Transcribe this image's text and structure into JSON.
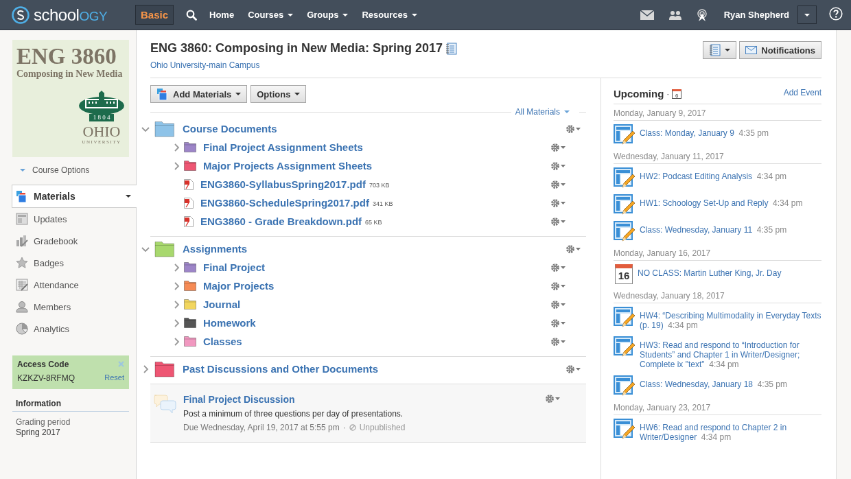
{
  "topbar": {
    "logo": {
      "text_1": "school",
      "text_2": "OGY"
    },
    "mode_button": "Basic",
    "menus": [
      {
        "label": "Home",
        "dropdown": false
      },
      {
        "label": "Courses",
        "dropdown": true
      },
      {
        "label": "Groups",
        "dropdown": true
      },
      {
        "label": "Resources",
        "dropdown": true
      }
    ],
    "user_name": "Ryan Shepherd"
  },
  "sidebar": {
    "course_image": {
      "title": "ENG 3860",
      "subtitle": "Composing in New Media",
      "year": "1 8 0 4",
      "name": "OHIO",
      "label": "UNIVERSITY"
    },
    "course_options": "Course Options",
    "nav": [
      {
        "label": "Materials",
        "selected": true
      },
      {
        "label": "Updates",
        "selected": false
      },
      {
        "label": "Gradebook",
        "selected": false
      },
      {
        "label": "Badges",
        "selected": false
      },
      {
        "label": "Attendance",
        "selected": false
      },
      {
        "label": "Members",
        "selected": false
      },
      {
        "label": "Analytics",
        "selected": false
      }
    ],
    "access_code": {
      "label": "Access Code",
      "code": "KZKZV-8RFMQ",
      "reset": "Reset"
    },
    "information": {
      "heading": "Information",
      "label": "Grading period",
      "value": "Spring 2017"
    }
  },
  "header": {
    "title": "ENG 3860: Composing in New Media: Spring 2017",
    "subtitle": "Ohio University-main Campus",
    "notifications_button": "Notifications"
  },
  "toolbar": {
    "add_materials": "Add Materials",
    "options": "Options",
    "filter": "All Materials"
  },
  "materials": [
    {
      "kind": "folder",
      "name": "Course Documents",
      "color": "#8ec3e8",
      "expanded": true,
      "children": [
        {
          "kind": "folder",
          "name": "Final Project Assignment Sheets",
          "color": "#9d85c8",
          "expanded": false
        },
        {
          "kind": "folder",
          "name": "Major Projects Assignment Sheets",
          "color": "#ee5673",
          "expanded": false
        },
        {
          "kind": "file",
          "name": "ENG3860-SyllabusSpring2017.pdf",
          "size": "703 KB"
        },
        {
          "kind": "file",
          "name": "ENG3860-ScheduleSpring2017.pdf",
          "size": "341 KB"
        },
        {
          "kind": "file",
          "name": "ENG3860 - Grade Breakdown.pdf",
          "size": "65 KB"
        }
      ]
    },
    {
      "kind": "folder",
      "name": "Assignments",
      "color": "#a8d86e",
      "expanded": true,
      "children": [
        {
          "kind": "folder",
          "name": "Final Project",
          "color": "#9d85c8",
          "expanded": false
        },
        {
          "kind": "folder",
          "name": "Major Projects",
          "color": "#f68b55",
          "expanded": false
        },
        {
          "kind": "folder",
          "name": "Journal",
          "color": "#f2d65e",
          "expanded": false
        },
        {
          "kind": "folder",
          "name": "Homework",
          "color": "#555555",
          "expanded": false
        },
        {
          "kind": "folder",
          "name": "Classes",
          "color": "#f198c0",
          "expanded": false
        }
      ]
    },
    {
      "kind": "folder",
      "name": "Past Discussions and Other Documents",
      "color": "#ee5673",
      "expanded": false
    },
    {
      "kind": "discussion",
      "name": "Final Project Discussion",
      "description": "Post a minimum of three questions per day of presentations.",
      "due": "Due Wednesday, April 19, 2017 at 5:55 pm",
      "separator": "·",
      "status": "Unpublished"
    }
  ],
  "upcoming": {
    "title": "Upcoming",
    "separator": "·",
    "calendar_day": "6",
    "add_event": "Add Event",
    "days": [
      {
        "date": "Monday, January 9, 2017",
        "events": [
          {
            "kind": "assignment",
            "title": "Class: Monday, January 9",
            "time": "4:35 pm"
          }
        ]
      },
      {
        "date": "Wednesday, January 11, 2017",
        "events": [
          {
            "kind": "assignment",
            "title": "HW2: Podcast Editing Analysis",
            "time": "4:34 pm"
          },
          {
            "kind": "assignment",
            "title": "HW1: Schoology Set-Up and Reply",
            "time": "4:34 pm"
          },
          {
            "kind": "assignment",
            "title": "Class: Wednesday, January 11",
            "time": "4:35 pm"
          }
        ]
      },
      {
        "date": "Monday, January 16, 2017",
        "events": [
          {
            "kind": "event",
            "day": "16",
            "title": "NO CLASS: Martin Luther King, Jr. Day"
          }
        ]
      },
      {
        "date": "Wednesday, January 18, 2017",
        "events": [
          {
            "kind": "assignment",
            "title": "HW4: “Describing Multimodality in Everyday Texts (p. 19)",
            "time": "4:34 pm"
          },
          {
            "kind": "assignment",
            "title": "HW3: Read and respond to “Introduction for Students” and Chapter 1 in Writer/Designer; Complete ix \"text\"",
            "time": "4:34 pm"
          },
          {
            "kind": "assignment",
            "title": "Class: Wednesday, January 18",
            "time": "4:35 pm"
          }
        ]
      },
      {
        "date": "Monday, January 23, 2017",
        "events": [
          {
            "kind": "assignment",
            "title": "HW6: Read and respond to Chapter 2 in Writer/Designer",
            "time": "4:34 pm"
          }
        ]
      }
    ]
  }
}
